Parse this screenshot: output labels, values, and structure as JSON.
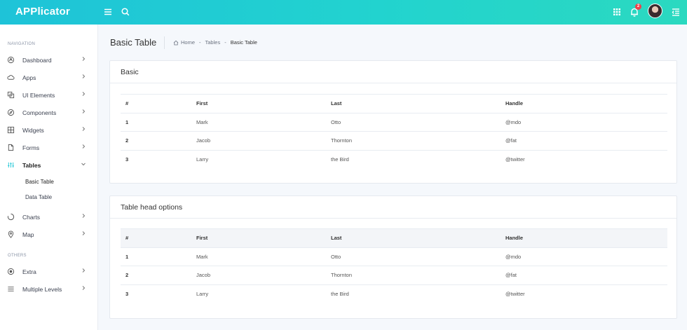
{
  "header": {
    "logo": "APPlicator",
    "notification_count": "2",
    "icons": [
      "menu-icon",
      "search-icon",
      "apps-grid-icon",
      "bell-icon",
      "avatar",
      "right-panel-icon"
    ]
  },
  "sidebar": {
    "section_navigation": "Navigation",
    "section_others": "Others",
    "items": [
      {
        "label": "Dashboard",
        "icon": "dashboard-icon"
      },
      {
        "label": "Apps",
        "icon": "cloud-icon"
      },
      {
        "label": "UI Elements",
        "icon": "copy-icon"
      },
      {
        "label": "Components",
        "icon": "compass-icon"
      },
      {
        "label": "Widgets",
        "icon": "grid-icon"
      },
      {
        "label": "Forms",
        "icon": "file-icon"
      },
      {
        "label": "Tables",
        "icon": "sliders-icon"
      },
      {
        "label": "Charts",
        "icon": "pie-chart-icon"
      },
      {
        "label": "Map",
        "icon": "map-pin-icon"
      }
    ],
    "sub_items": [
      {
        "label": "Basic Table"
      },
      {
        "label": "Data Table"
      }
    ],
    "others": [
      {
        "label": "Extra",
        "icon": "target-icon"
      },
      {
        "label": "Multiple Levels",
        "icon": "list-icon"
      }
    ]
  },
  "page": {
    "title": "Basic Table",
    "breadcrumb": [
      "Home",
      "-",
      "Tables",
      "-",
      "Basic Table"
    ]
  },
  "cards": [
    {
      "title": "Basic",
      "headers": [
        "#",
        "First",
        "Last",
        "Handle"
      ],
      "rows": [
        [
          "1",
          "Mark",
          "Otto",
          "@mdo"
        ],
        [
          "2",
          "Jacob",
          "Thornton",
          "@fat"
        ],
        [
          "3",
          "Larry",
          "the Bird",
          "@twitter"
        ]
      ]
    },
    {
      "title": "Table head options",
      "headers": [
        "#",
        "First",
        "Last",
        "Handle"
      ],
      "rows": [
        [
          "1",
          "Mark",
          "Otto",
          "@mdo"
        ],
        [
          "2",
          "Jacob",
          "Thornton",
          "@fat"
        ],
        [
          "3",
          "Larry",
          "the Bird",
          "@twitter"
        ]
      ]
    }
  ],
  "colors": {
    "header_gradient_start": "#1ec3d8",
    "header_gradient_end": "#2bd9c0",
    "accent": "#1fc6d6",
    "badge": "#f1404b"
  }
}
